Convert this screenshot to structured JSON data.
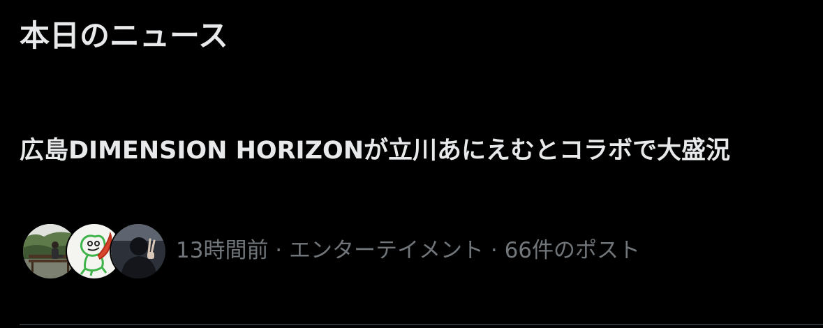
{
  "section": {
    "title": "本日のニュース"
  },
  "news_item": {
    "headline": "広島DIMENSION HORIZONが立川あにえむとコラボで大盛況",
    "meta": {
      "time": "13時間前",
      "separator": " · ",
      "category": "エンターテイメント",
      "post_count": "66件のポスト"
    },
    "avatars": [
      {
        "icon": "person-on-bench-photo"
      },
      {
        "icon": "green-sketch-character-illustration"
      },
      {
        "icon": "person-peace-sign-photo"
      }
    ]
  },
  "colors": {
    "background": "#000000",
    "primary_text": "#e7e9ea",
    "secondary_text": "#71767b",
    "divider": "#2f3336"
  }
}
